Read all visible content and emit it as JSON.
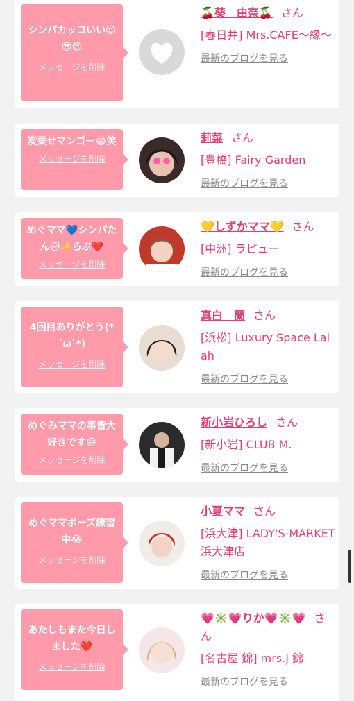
{
  "delete_label": "メッセージを削除",
  "blog_label": "最新のブログを見る",
  "honorific": "さん",
  "colors": {
    "bubble": "#ff9aab",
    "accent": "#e23e71",
    "link_gray": "#888888",
    "background": "#f2f2f2"
  },
  "items": [
    {
      "message": "シンパカッコいい😍😎😍",
      "name": "🍒葵　由奈🍒",
      "shop": "[春日井] Mrs.CAFE〜縁〜",
      "avatar_icon": "heart-photo"
    },
    {
      "message": "炭乗せマンゴー😂笑",
      "name": "莉菜",
      "shop": "[豊橋] Fairy Garden",
      "avatar_icon": "woman-photo"
    },
    {
      "message": "めぐママ💙シンパたん🐱✨らぶ❤️",
      "name": "💛しずかママ💛",
      "shop": "[中洲] ラピュー",
      "avatar_icon": "woman-photo"
    },
    {
      "message": "4回目ありがとう(*´ω`*)",
      "name": "真白　蘭",
      "shop": "[浜松] Luxury Space Lalah",
      "avatar_icon": "woman-photo"
    },
    {
      "message": "めぐみママの事皆大好きです😄",
      "name": "新小岩ひろし",
      "shop": "[新小岩] CLUB M.",
      "avatar_icon": "man-photo"
    },
    {
      "message": "めぐママポーズ練習中😂",
      "name": "小夏ママ",
      "shop": "[浜大津] LADY'S-MARKET 浜大津店",
      "avatar_icon": "woman-photo"
    },
    {
      "message": "あたしもまた今日しました❤️",
      "name": "💗✳️💗りか💗✳️💗",
      "shop": "[名古屋 錦] mrs.J 錦",
      "avatar_icon": "woman-photo"
    }
  ]
}
